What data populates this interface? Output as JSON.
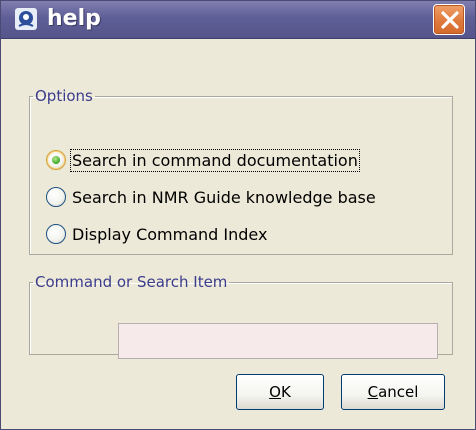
{
  "window": {
    "title": "help",
    "icon": "java-duke-icon",
    "close_icon": "close-icon",
    "colors": {
      "titlebar": "#6a6aa0",
      "close": "#e07a3c",
      "background": "#ece9d8",
      "legend": "#3c3c8c"
    }
  },
  "options": {
    "legend": "Options",
    "items": [
      {
        "label": "Search in command documentation",
        "selected": true
      },
      {
        "label": "Search in NMR Guide knowledge base",
        "selected": false
      },
      {
        "label": "Display Command Index",
        "selected": false
      }
    ]
  },
  "search": {
    "legend": "Command or Search Item",
    "value": "",
    "placeholder": ""
  },
  "buttons": {
    "ok": {
      "mnemonic": "O",
      "rest": "K"
    },
    "cancel": {
      "mnemonic": "C",
      "rest": "ancel"
    }
  }
}
